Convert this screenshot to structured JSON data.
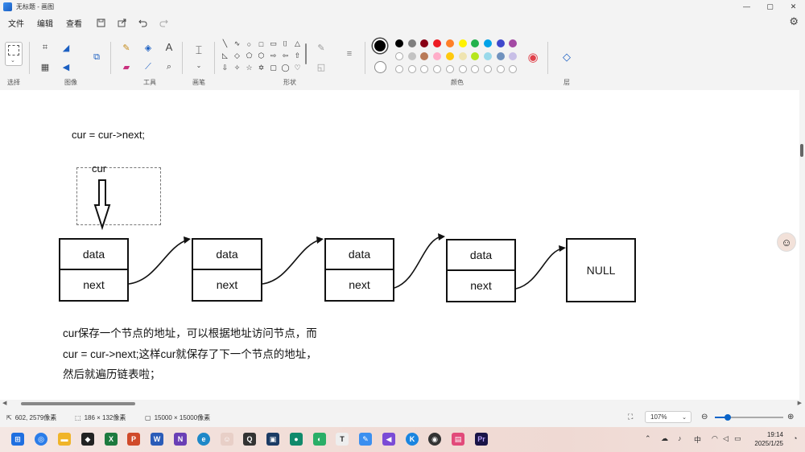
{
  "window": {
    "title": "无标题 - 画图",
    "controls": {
      "minimize": "—",
      "maximize": "▢",
      "close": "✕"
    }
  },
  "menu": {
    "items": [
      "文件",
      "编辑",
      "查看"
    ],
    "icons": [
      "save-icon",
      "share-icon",
      "undo-icon",
      "redo-icon",
      "settings-icon"
    ]
  },
  "ribbon": {
    "groups": {
      "select": "选择",
      "image": "图像",
      "tools": "工具",
      "brushes": "画笔",
      "shapes": "形状",
      "colors": "颜色",
      "layers": "层"
    },
    "shapes": [
      "╲",
      "∿",
      "○",
      "□",
      "▭",
      "⌷",
      "△",
      "◺",
      "◇",
      "⬠",
      "⬡",
      "⇨",
      "⇦",
      "⇧",
      "⇩",
      "✧",
      "☆",
      "✡",
      "▢",
      "◯",
      "♡"
    ],
    "colors_row1": [
      "#000000",
      "#7f7f7f",
      "#880015",
      "#ed1c24",
      "#ff7f27",
      "#fff200",
      "#22b14c",
      "#00a2e8",
      "#3f48cc",
      "#a349a4"
    ],
    "colors_row2": [
      "#ffffff",
      "#c3c3c3",
      "#b97a57",
      "#ffaec9",
      "#ffc90e",
      "#efe4b0",
      "#b5e61d",
      "#99d9ea",
      "#7092be",
      "#c8bfe7"
    ],
    "active_color": "#000000"
  },
  "canvas": {
    "code_line": "cur = cur->next;",
    "cur_label": "cur",
    "nodes": [
      {
        "data": "data",
        "next": "next"
      },
      {
        "data": "data",
        "next": "next"
      },
      {
        "data": "data",
        "next": "next"
      },
      {
        "data": "data",
        "next": "next"
      }
    ],
    "null_label": "NULL",
    "notes": [
      "cur保存一个节点的地址，可以根据地址访问节点，而",
      "cur = cur->next;这样cur就保存了下一个节点的地址，",
      "然后就遍历链表啦；"
    ]
  },
  "status": {
    "cursor_pos": "602, 2579像素",
    "selection_size": "186 × 132像素",
    "canvas_size": "15000 × 15000像素",
    "zoom": "107%"
  },
  "taskbar": {
    "time": "19:14",
    "date": "2025/1/25",
    "ime": "中"
  }
}
